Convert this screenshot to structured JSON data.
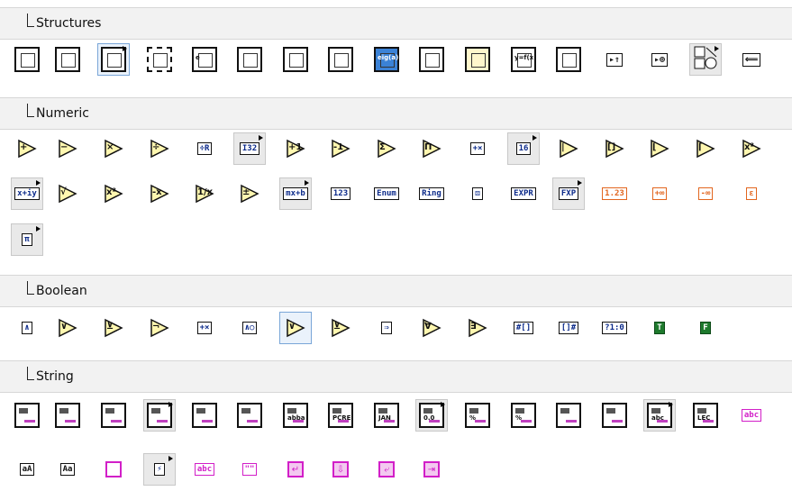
{
  "sections": [
    {
      "title": "Structures",
      "rows": [
        [
          {
            "icon": "flat-sequence-icon",
            "kind": "struct",
            "sub": false
          },
          {
            "icon": "case-structure-icon",
            "kind": "struct",
            "sub": false
          },
          {
            "icon": "event-structure-icon",
            "kind": "struct",
            "sub": true,
            "selected": true
          },
          {
            "icon": "diagram-disable-icon",
            "kind": "struct-dash",
            "sub": false
          },
          {
            "icon": "element-in-place-icon",
            "kind": "struct-e",
            "text": "e",
            "sub": false
          },
          {
            "icon": "for-loop-icon",
            "kind": "struct",
            "sub": false
          },
          {
            "icon": "while-loop-icon",
            "kind": "struct",
            "sub": false
          },
          {
            "icon": "timed-structure-icon",
            "kind": "struct",
            "sub": false
          },
          {
            "icon": "mathscript-node-icon",
            "kind": "struct-blue",
            "text": "eig(a)",
            "sub": false
          },
          {
            "icon": "stacked-sequence-icon",
            "kind": "struct",
            "sub": false
          },
          {
            "icon": "conditional-disable-icon",
            "kind": "struct-yellow",
            "sub": false
          },
          {
            "icon": "formula-node-icon",
            "kind": "struct",
            "text": "y=f(x)",
            "sub": false
          },
          {
            "icon": "in-place-element-icon",
            "kind": "struct",
            "sub": false
          },
          {
            "icon": "shift-register-icon",
            "kind": "arrow",
            "text": "▸⇑",
            "sub": false
          },
          {
            "icon": "feedback-node-icon",
            "kind": "arrow",
            "text": "▸⊕",
            "sub": false
          },
          {
            "icon": "global-variable-icon",
            "kind": "shapes",
            "sub": true
          },
          {
            "icon": "local-variable-icon",
            "kind": "arrow",
            "text": "⟸",
            "sub": false
          }
        ]
      ]
    },
    {
      "title": "Numeric",
      "rows": [
        [
          {
            "icon": "add-icon",
            "kind": "tri",
            "text": "+"
          },
          {
            "icon": "subtract-icon",
            "kind": "tri",
            "text": "−"
          },
          {
            "icon": "multiply-icon",
            "kind": "tri",
            "text": "×"
          },
          {
            "icon": "divide-icon",
            "kind": "tri",
            "text": "÷"
          },
          {
            "icon": "quotient-remainder-icon",
            "kind": "boxed",
            "text": "÷R",
            "sub": false
          },
          {
            "icon": "conversion-icon",
            "kind": "boxed",
            "text": "I32",
            "sub": true
          },
          {
            "icon": "increment-icon",
            "kind": "tri",
            "text": "+1"
          },
          {
            "icon": "decrement-icon",
            "kind": "tri",
            "text": "-1"
          },
          {
            "icon": "add-array-elements-icon",
            "kind": "tri",
            "text": "Σ"
          },
          {
            "icon": "multiply-array-elements-icon",
            "kind": "tri",
            "text": "Π"
          },
          {
            "icon": "compound-arithmetic-icon",
            "kind": "boxed",
            "text": "+×",
            "sub": false
          },
          {
            "icon": "data-manipulation-icon",
            "kind": "boxed",
            "text": "16",
            "sub": true
          },
          {
            "icon": "absolute-value-icon",
            "kind": "tri",
            "text": "|"
          },
          {
            "icon": "round-nearest-icon",
            "kind": "tri",
            "text": "[]"
          },
          {
            "icon": "round-down-icon",
            "kind": "tri",
            "text": "⌊"
          },
          {
            "icon": "round-up-icon",
            "kind": "tri",
            "text": "⌈"
          },
          {
            "icon": "scale-power-icon",
            "kind": "tri",
            "text": "x²"
          }
        ],
        [
          {
            "icon": "complex-icon",
            "kind": "boxed",
            "text": "x+iy",
            "sub": true
          },
          {
            "icon": "square-root-icon",
            "kind": "tri",
            "text": "√"
          },
          {
            "icon": "square-icon",
            "kind": "tri",
            "text": "x²"
          },
          {
            "icon": "negate-icon",
            "kind": "tri",
            "text": "-x"
          },
          {
            "icon": "reciprocal-icon",
            "kind": "tri",
            "text": "1/x"
          },
          {
            "icon": "sign-icon",
            "kind": "tri",
            "text": "±"
          },
          {
            "icon": "linear-evaluation-icon",
            "kind": "boxed",
            "text": "mx+b",
            "sub": true
          },
          {
            "icon": "numeric-constant-icon",
            "kind": "boxed",
            "text": "123"
          },
          {
            "icon": "enum-constant-icon",
            "kind": "boxed",
            "text": "Enum"
          },
          {
            "icon": "ring-constant-icon",
            "kind": "boxed",
            "text": "Ring"
          },
          {
            "icon": "random-number-icon",
            "kind": "boxed",
            "text": "⚄"
          },
          {
            "icon": "expression-node-icon",
            "kind": "boxed",
            "text": "EXPR"
          },
          {
            "icon": "fixed-point-icon",
            "kind": "boxed",
            "text": "FXP",
            "sub": true
          },
          {
            "icon": "dbl-constant-icon",
            "kind": "boxed-orange",
            "text": "1.23"
          },
          {
            "icon": "pos-infinity-icon",
            "kind": "boxed-orange",
            "text": "+∞"
          },
          {
            "icon": "neg-infinity-icon",
            "kind": "boxed-orange",
            "text": "-∞"
          },
          {
            "icon": "epsilon-icon",
            "kind": "boxed-orange",
            "text": "ε"
          }
        ],
        [
          {
            "icon": "math-constants-icon",
            "kind": "boxed",
            "text": "π",
            "sub": true
          }
        ]
      ]
    },
    {
      "title": "Boolean",
      "rows": [
        [
          {
            "icon": "and-icon",
            "kind": "boxed",
            "text": "∧"
          },
          {
            "icon": "or-icon",
            "kind": "tri",
            "text": "∨"
          },
          {
            "icon": "exclusive-or-icon",
            "kind": "tri",
            "text": "⊻"
          },
          {
            "icon": "not-icon",
            "kind": "tri",
            "text": "¬"
          },
          {
            "icon": "compound-boolean-icon",
            "kind": "boxed",
            "text": "+×"
          },
          {
            "icon": "not-and-icon",
            "kind": "boxed",
            "text": "∧○"
          },
          {
            "icon": "not-or-icon",
            "kind": "tri",
            "text": "∨",
            "selected": true
          },
          {
            "icon": "not-exclusive-or-icon",
            "kind": "tri",
            "text": "⊻"
          },
          {
            "icon": "implies-icon",
            "kind": "boxed",
            "text": "⇒"
          },
          {
            "icon": "and-array-icon",
            "kind": "tri",
            "text": "∀"
          },
          {
            "icon": "or-array-icon",
            "kind": "tri",
            "text": "∃"
          },
          {
            "icon": "number-to-bool-array-icon",
            "kind": "boxed",
            "text": "#[]"
          },
          {
            "icon": "bool-array-to-number-icon",
            "kind": "boxed",
            "text": "[]#"
          },
          {
            "icon": "bool-to-01-icon",
            "kind": "boxed",
            "text": "?1:0"
          },
          {
            "icon": "true-constant-icon",
            "kind": "boxed-green",
            "text": "T"
          },
          {
            "icon": "false-constant-icon",
            "kind": "boxed-green",
            "text": "F"
          }
        ]
      ]
    },
    {
      "title": "String",
      "rows": [
        [
          {
            "icon": "string-length-icon",
            "kind": "str"
          },
          {
            "icon": "concatenate-strings-icon",
            "kind": "str"
          },
          {
            "icon": "string-subset-icon",
            "kind": "str"
          },
          {
            "icon": "replace-substring-icon",
            "kind": "str",
            "sub": true
          },
          {
            "icon": "search-replace-icon",
            "kind": "str"
          },
          {
            "icon": "match-pattern-icon",
            "kind": "str"
          },
          {
            "icon": "match-regex-icon",
            "kind": "str",
            "text": "abba"
          },
          {
            "icon": "search-split-icon",
            "kind": "str",
            "text": "PCRE"
          },
          {
            "icon": "format-date-time-icon",
            "kind": "str",
            "text": "JAN"
          },
          {
            "icon": "scan-number-icon",
            "kind": "str",
            "text": "0.0",
            "sub": true
          },
          {
            "icon": "format-into-string-icon",
            "kind": "str",
            "text": "%"
          },
          {
            "icon": "scan-from-string-icon",
            "kind": "str",
            "text": "%"
          },
          {
            "icon": "build-text-icon",
            "kind": "str"
          },
          {
            "icon": "spreadsheet-to-array-icon",
            "kind": "str"
          },
          {
            "icon": "string-conversion-icon",
            "kind": "str",
            "text": "abc",
            "sub": true
          },
          {
            "icon": "array-to-spreadsheet-icon",
            "kind": "str",
            "text": "LEC"
          },
          {
            "icon": "trim-whitespace-icon",
            "kind": "boxed-magenta",
            "text": "abc"
          }
        ],
        [
          {
            "icon": "to-lower-case-icon",
            "kind": "boxed-dark",
            "text": "aA"
          },
          {
            "icon": "to-upper-case-icon",
            "kind": "boxed-dark",
            "text": "Aa"
          },
          {
            "icon": "string-constant-icon",
            "kind": "magsq"
          },
          {
            "icon": "additional-string-icon",
            "kind": "boxed",
            "text": "⚡",
            "sub": true
          },
          {
            "icon": "space-constant-icon",
            "kind": "boxed-magenta",
            "text": "abc"
          },
          {
            "icon": "empty-string-icon",
            "kind": "boxed-magenta",
            "text": "\"\""
          },
          {
            "icon": "carriage-return-icon",
            "kind": "magsq-fill",
            "text": "↵"
          },
          {
            "icon": "line-feed-icon",
            "kind": "magsq-fill",
            "text": "⇩"
          },
          {
            "icon": "eol-constant-icon",
            "kind": "magsq-fill",
            "text": "⤶"
          },
          {
            "icon": "tab-constant-icon",
            "kind": "magsq-fill",
            "text": "⇥"
          }
        ]
      ]
    }
  ]
}
